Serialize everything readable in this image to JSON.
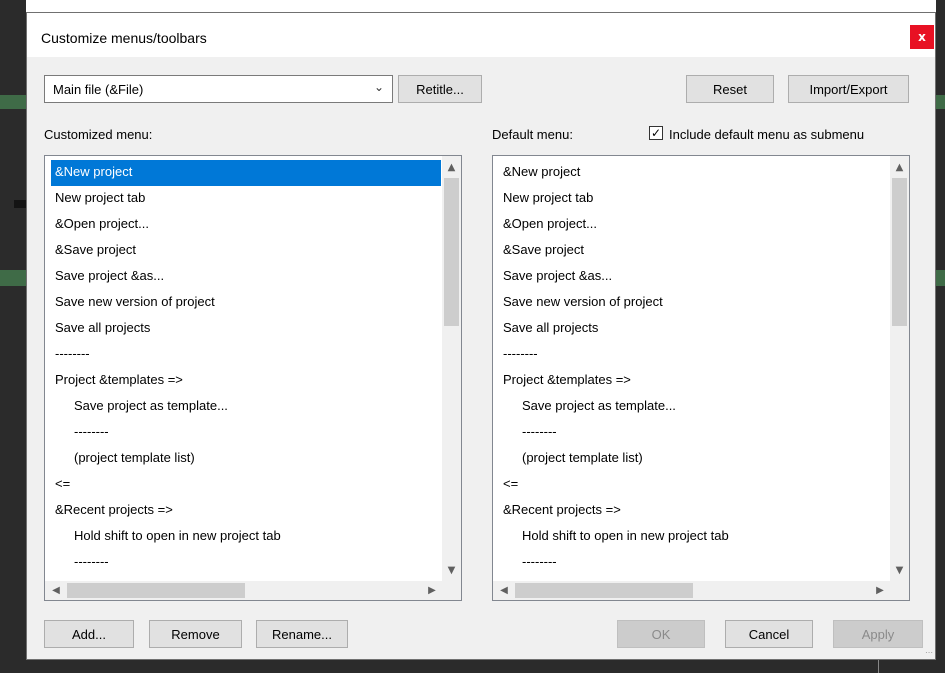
{
  "dialog": {
    "title": "Customize menus/toolbars",
    "close_label": "x"
  },
  "menu_select": {
    "value": "Main file (&File)"
  },
  "toolbar": {
    "retitle_label": "Retitle...",
    "reset_label": "Reset",
    "import_export_label": "Import/Export"
  },
  "customized": {
    "label": "Customized menu:",
    "items": [
      {
        "text": "&New project",
        "indent": 0,
        "selected": true
      },
      {
        "text": "New project tab",
        "indent": 0
      },
      {
        "text": "&Open project...",
        "indent": 0
      },
      {
        "text": "&Save project",
        "indent": 0
      },
      {
        "text": "Save project &as...",
        "indent": 0
      },
      {
        "text": "Save new version of project",
        "indent": 0
      },
      {
        "text": "Save all projects",
        "indent": 0
      },
      {
        "text": "--------",
        "indent": 0
      },
      {
        "text": "Project &templates =>",
        "indent": 0
      },
      {
        "text": "Save project as template...",
        "indent": 1
      },
      {
        "text": "--------",
        "indent": 1
      },
      {
        "text": "(project template list)",
        "indent": 1
      },
      {
        "text": "<=",
        "indent": 0
      },
      {
        "text": "&Recent projects =>",
        "indent": 0
      },
      {
        "text": "Hold shift to open in new project tab",
        "indent": 1
      },
      {
        "text": "--------",
        "indent": 1
      }
    ]
  },
  "default": {
    "label": "Default menu:",
    "include_label": "Include default menu as submenu",
    "include_checked": true,
    "items": [
      {
        "text": "&New project",
        "indent": 0
      },
      {
        "text": "New project tab",
        "indent": 0
      },
      {
        "text": "&Open project...",
        "indent": 0
      },
      {
        "text": "&Save project",
        "indent": 0
      },
      {
        "text": "Save project &as...",
        "indent": 0
      },
      {
        "text": "Save new version of project",
        "indent": 0
      },
      {
        "text": "Save all projects",
        "indent": 0
      },
      {
        "text": "--------",
        "indent": 0
      },
      {
        "text": "Project &templates =>",
        "indent": 0
      },
      {
        "text": "Save project as template...",
        "indent": 1
      },
      {
        "text": "--------",
        "indent": 1
      },
      {
        "text": "(project template list)",
        "indent": 1
      },
      {
        "text": "<=",
        "indent": 0
      },
      {
        "text": "&Recent projects =>",
        "indent": 0
      },
      {
        "text": "Hold shift to open in new project tab",
        "indent": 1
      },
      {
        "text": "--------",
        "indent": 1
      }
    ]
  },
  "bottom": {
    "add_label": "Add...",
    "remove_label": "Remove",
    "rename_label": "Rename...",
    "ok_label": "OK",
    "cancel_label": "Cancel",
    "apply_label": "Apply"
  },
  "icons": {
    "chevron_down": "chevron-down-icon",
    "scroll_up": "scroll-up-icon",
    "scroll_down": "scroll-down-icon",
    "scroll_left": "scroll-left-icon",
    "scroll_right": "scroll-right-icon",
    "check": "checkmark-icon"
  },
  "colors": {
    "selection": "#0078d7",
    "close_button": "#e81123"
  }
}
